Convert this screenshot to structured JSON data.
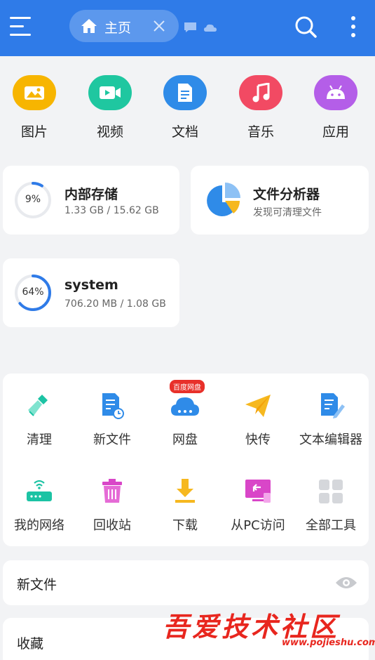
{
  "header": {
    "tab_label": "主页",
    "accent": "#2f7be8"
  },
  "categories": [
    {
      "label": "图片",
      "color": "#f7b500",
      "icon": "image-icon"
    },
    {
      "label": "视频",
      "color": "#1fc7a0",
      "icon": "video-icon"
    },
    {
      "label": "文档",
      "color": "#2f8be8",
      "icon": "document-icon"
    },
    {
      "label": "音乐",
      "color": "#f24a63",
      "icon": "music-icon"
    },
    {
      "label": "应用",
      "color": "#b45ee8",
      "icon": "android-icon"
    }
  ],
  "internal_storage": {
    "title": "内部存储",
    "usage": "1.33 GB / 15.62 GB",
    "percent_label": "9%",
    "percent": 9
  },
  "analyzer": {
    "title": "文件分析器",
    "subtitle": "发现可清理文件"
  },
  "system_storage": {
    "title": "system",
    "usage": "706.20 MB / 1.08 GB",
    "percent_label": "64%",
    "percent": 64
  },
  "tools": {
    "badge": "百度网盘",
    "items": [
      {
        "label": "清理",
        "icon": "broom-icon"
      },
      {
        "label": "新文件",
        "icon": "new-file-icon"
      },
      {
        "label": "网盘",
        "icon": "cloud-drive-icon"
      },
      {
        "label": "快传",
        "icon": "paper-plane-icon"
      },
      {
        "label": "文本编辑器",
        "icon": "text-editor-icon"
      },
      {
        "label": "我的网络",
        "icon": "router-icon"
      },
      {
        "label": "回收站",
        "icon": "trash-icon"
      },
      {
        "label": "下载",
        "icon": "download-icon"
      },
      {
        "label": "从PC访问",
        "icon": "pc-access-icon"
      },
      {
        "label": "全部工具",
        "icon": "grid-icon"
      }
    ]
  },
  "new_files": {
    "title": "新文件"
  },
  "favorites": {
    "title": "收藏"
  },
  "watermark": {
    "text": "吾爱技术社区",
    "url": "www.pojieshu.com"
  }
}
